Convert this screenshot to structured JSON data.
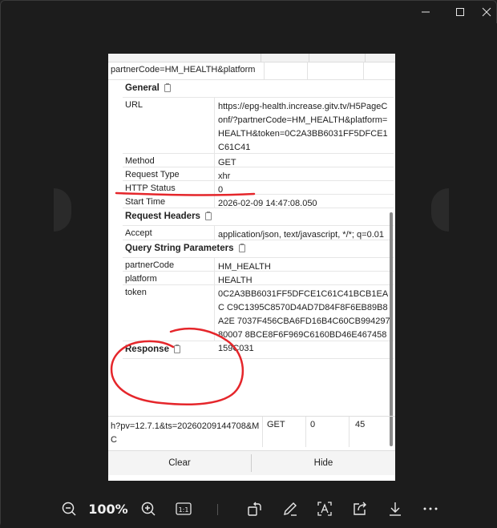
{
  "window": {
    "title": ""
  },
  "devtool": {
    "url_row": "partnerCode=HM_HEALTH&platform",
    "general": {
      "title": "General",
      "rows": [
        {
          "key": "URL",
          "value": "https://epg-health.increase.gitv.tv/H5PageConf/?partnerCode=HM_HEALTH&platform=HEALTH&token=0C2A3BB6031FF5DFCE1C61C41"
        },
        {
          "key": "Method",
          "value": "GET"
        },
        {
          "key": "Request Type",
          "value": "xhr"
        },
        {
          "key": "HTTP Status",
          "value": "0"
        },
        {
          "key": "Start Time",
          "value": "2026-02-09 14:47:08.050"
        }
      ]
    },
    "request_headers": {
      "title": "Request Headers",
      "rows": [
        {
          "key": "Accept",
          "value": "application/json, text/javascript, */*; q=0.01"
        }
      ]
    },
    "query_params": {
      "title": "Query String Parameters",
      "rows": [
        {
          "key": "partnerCode",
          "value": "HM_HEALTH"
        },
        {
          "key": "platform",
          "value": "HEALTH"
        },
        {
          "key": "token",
          "value": "0C2A3BB6031FF5DFCE1C61C41BCB1EAC C9C1395C8570D4AD7D84F8F6EB89B8A2E 7037F456CBA6FD16B4C60CB99429780007 8BCE8F6F969C6160BD46E467458159C031"
        }
      ]
    },
    "response": {
      "title": "Response"
    },
    "request_row": {
      "name": "h?pv=12.7.1&ts=20260209144708&MC",
      "method": "GET",
      "status": "0",
      "time": "45"
    },
    "buttons": {
      "clear": "Clear",
      "hide": "Hide"
    }
  },
  "toolbar": {
    "zoom_level": "100%",
    "icons": [
      "zoom-out-icon",
      "zoom-in-icon",
      "actual-size-icon",
      "rotate-icon",
      "edit-icon",
      "text-select-icon",
      "share-icon",
      "download-icon",
      "more-icon"
    ],
    "actual_size_label": "1:1"
  },
  "annotation_color": "#e5262b"
}
